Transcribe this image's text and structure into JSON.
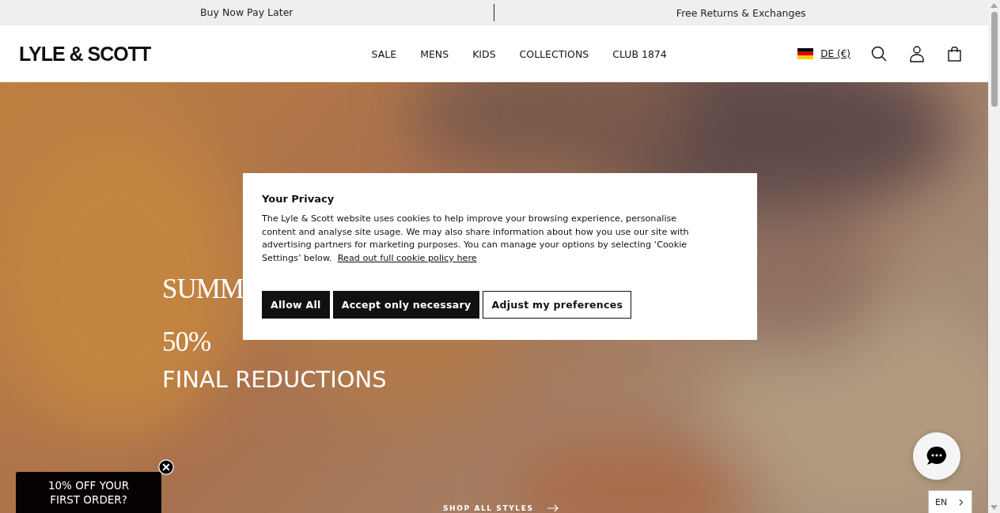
{
  "promo_bar": [
    "Buy Now Pay Later",
    "Free Returns & Exchanges"
  ],
  "header": {
    "logo": "LYLE & SCOTT",
    "nav": [
      "SALE",
      "MENS",
      "KIDS",
      "COLLECTIONS",
      "CLUB 1874"
    ],
    "region": "DE (€)"
  },
  "hero": {
    "lines": [
      "SUMM",
      "50%"
    ],
    "subtitle": "FINAL REDUCTIONS",
    "link": "SHOP ALL STYLES"
  },
  "cookie_dialog": {
    "title": "Your Privacy",
    "text": "The Lyle & Scott website uses cookies to help improve your browsing experience, personalise content and analyse site usage. We may also share information about how you use our site with advertising partners for marketing purposes. You can manage your options by selecting ‘Cookie Settings’ below.",
    "link": "Read out full cookie policy here",
    "buttons": [
      {
        "label": "Allow All",
        "kind": "primary"
      },
      {
        "label": "Accept only necessary",
        "kind": "primary"
      },
      {
        "label": "Adjust my preferences",
        "kind": "outline"
      }
    ]
  },
  "offer_popup": {
    "text": "10% OFF YOUR FIRST ORDER?"
  },
  "language": {
    "label": "EN"
  }
}
